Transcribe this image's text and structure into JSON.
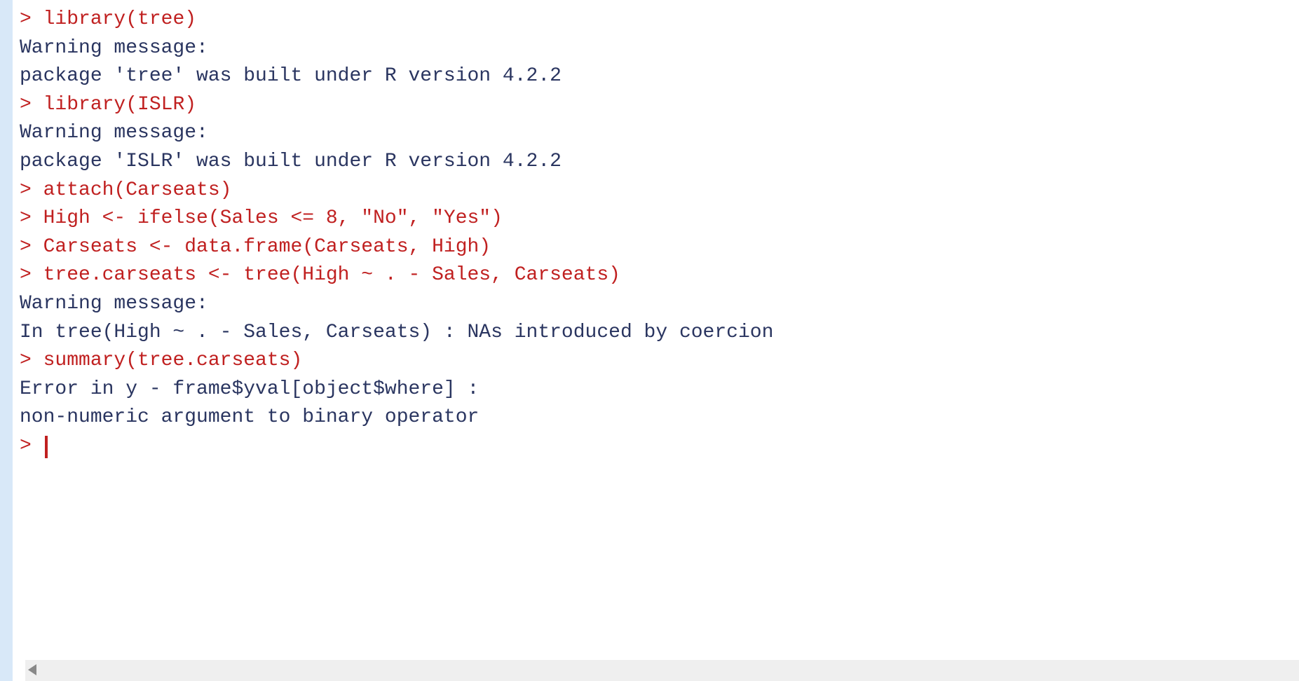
{
  "console": {
    "lines": [
      {
        "type": "input",
        "prompt": "> ",
        "text": "library(tree)"
      },
      {
        "type": "output",
        "text": "Warning message:"
      },
      {
        "type": "output",
        "text": "package 'tree' was built under R version 4.2.2 "
      },
      {
        "type": "input",
        "prompt": "> ",
        "text": "library(ISLR)"
      },
      {
        "type": "output",
        "text": "Warning message:"
      },
      {
        "type": "output",
        "text": "package 'ISLR' was built under R version 4.2.2 "
      },
      {
        "type": "input",
        "prompt": "> ",
        "text": "attach(Carseats)"
      },
      {
        "type": "input",
        "prompt": "> ",
        "text": "High <- ifelse(Sales <= 8, \"No\", \"Yes\")"
      },
      {
        "type": "input",
        "prompt": "> ",
        "text": "Carseats <- data.frame(Carseats, High)"
      },
      {
        "type": "input",
        "prompt": "> ",
        "text": "tree.carseats <- tree(High ~ . - Sales, Carseats)"
      },
      {
        "type": "output",
        "text": "Warning message:"
      },
      {
        "type": "output",
        "text": "In tree(High ~ . - Sales, Carseats) : NAs introduced by coercion"
      },
      {
        "type": "input",
        "prompt": "> ",
        "text": "summary(tree.carseats)"
      },
      {
        "type": "output",
        "text": "Error in y - frame$yval[object$where] : "
      },
      {
        "type": "output",
        "text": "  non-numeric argument to binary operator"
      },
      {
        "type": "prompt-only",
        "prompt": "> ",
        "text": ""
      }
    ]
  }
}
